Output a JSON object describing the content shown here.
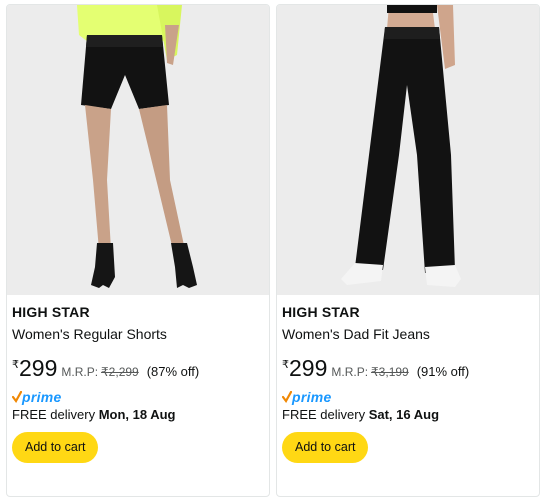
{
  "products": [
    {
      "brand": "HIGH STAR",
      "title": "Women's Regular Shorts",
      "currency": "₹",
      "price": "299",
      "mrp_label": "M.R.P:",
      "mrp": "₹2,299",
      "discount": "(87% off)",
      "prime": "prime",
      "delivery_prefix": "FREE delivery",
      "delivery_date": "Mon, 18 Aug",
      "cart_label": "Add to cart",
      "image_icon": "black-shorts-product-image"
    },
    {
      "brand": "HIGH STAR",
      "title": "Women's Dad Fit Jeans",
      "currency": "₹",
      "price": "299",
      "mrp_label": "M.R.P:",
      "mrp": "₹3,199",
      "discount": "(91% off)",
      "prime": "prime",
      "delivery_prefix": "FREE delivery",
      "delivery_date": "Sat, 16 Aug",
      "cart_label": "Add to cart",
      "image_icon": "black-jeans-product-image"
    }
  ],
  "colors": {
    "cart_button": "#ffd814",
    "prime_blue": "#1a98ff",
    "prime_check": "#f08804",
    "muted_text": "#565959"
  }
}
